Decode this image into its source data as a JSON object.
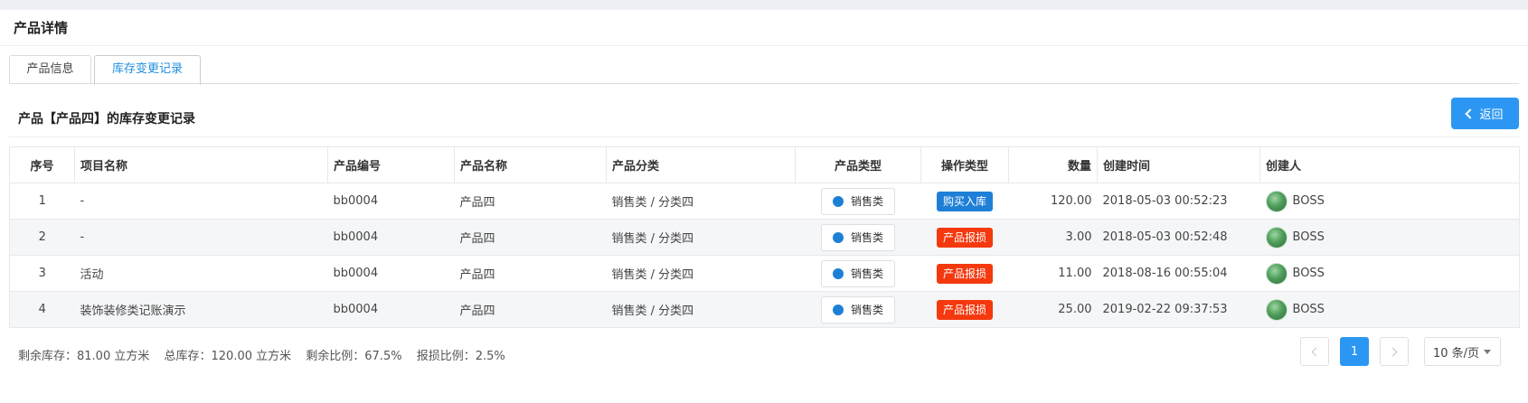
{
  "page": {
    "title": "产品详情"
  },
  "tabs": [
    {
      "label": "产品信息",
      "active": false
    },
    {
      "label": "库存变更记录",
      "active": true
    }
  ],
  "section": {
    "title": "产品【产品四】的库存变更记录",
    "back_label": "返回"
  },
  "table": {
    "headers": [
      "序号",
      "项目名称",
      "产品编号",
      "产品名称",
      "产品分类",
      "产品类型",
      "操作类型",
      "数量",
      "创建时间",
      "创建人"
    ],
    "rows": [
      {
        "index": "1",
        "project": "-",
        "code": "bb0004",
        "name": "产品四",
        "category": "销售类 / 分类四",
        "type": "销售类",
        "op": "购买入库",
        "op_color": "#1e7fd6",
        "qty": "120.00",
        "time": "2018-05-03 00:52:23",
        "creator": "BOSS"
      },
      {
        "index": "2",
        "project": "-",
        "code": "bb0004",
        "name": "产品四",
        "category": "销售类 / 分类四",
        "type": "销售类",
        "op": "产品报损",
        "op_color": "#f4390e",
        "qty": "3.00",
        "time": "2018-05-03 00:52:48",
        "creator": "BOSS"
      },
      {
        "index": "3",
        "project": "活动",
        "code": "bb0004",
        "name": "产品四",
        "category": "销售类 / 分类四",
        "type": "销售类",
        "op": "产品报损",
        "op_color": "#f4390e",
        "qty": "11.00",
        "time": "2018-08-16 00:55:04",
        "creator": "BOSS"
      },
      {
        "index": "4",
        "project": "装饰装修类记账演示",
        "code": "bb0004",
        "name": "产品四",
        "category": "销售类 / 分类四",
        "type": "销售类",
        "op": "产品报损",
        "op_color": "#f4390e",
        "qty": "25.00",
        "time": "2019-02-22 09:37:53",
        "creator": "BOSS"
      }
    ]
  },
  "summary": {
    "remaining": "剩余库存：81.00 立方米",
    "total": "总库存：120.00 立方米",
    "remaining_ratio": "剩余比例：67.5%",
    "loss_ratio": "报损比例：2.5%"
  },
  "pagination": {
    "current_page": "1",
    "page_size": "10 条/页"
  }
}
